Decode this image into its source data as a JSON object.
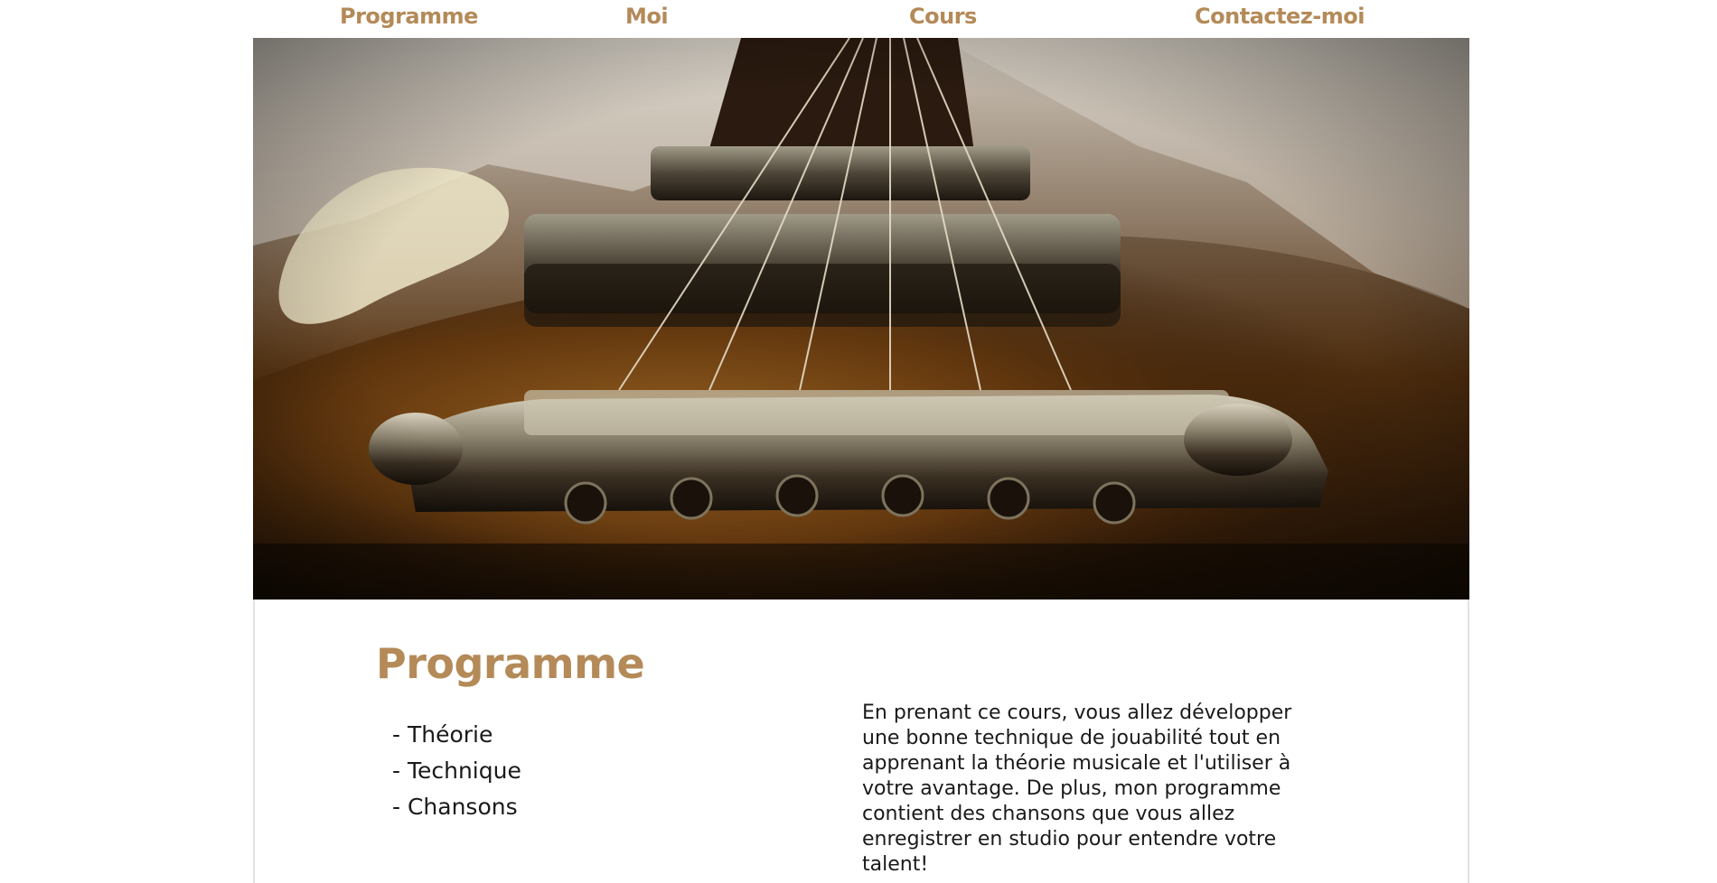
{
  "nav": {
    "items": [
      {
        "label": "Programme"
      },
      {
        "label": "Moi"
      },
      {
        "label": "Cours"
      },
      {
        "label": "Contactez-moi"
      }
    ]
  },
  "hero": {
    "image": "guitar-bridge-closeup-photo"
  },
  "programme": {
    "title": "Programme",
    "topics": [
      "- Théorie",
      "- Technique",
      "- Chansons"
    ],
    "description": "En prenant ce cours, vous allez développer une bonne technique de jouabilité tout en apprenant la théorie musicale et l'utiliser à votre avantage. De plus, mon programme contient des chansons que vous allez enregistrer en studio pour entendre votre talent!"
  },
  "colors": {
    "accent": "#b48a58",
    "text": "#1a1a1a"
  }
}
